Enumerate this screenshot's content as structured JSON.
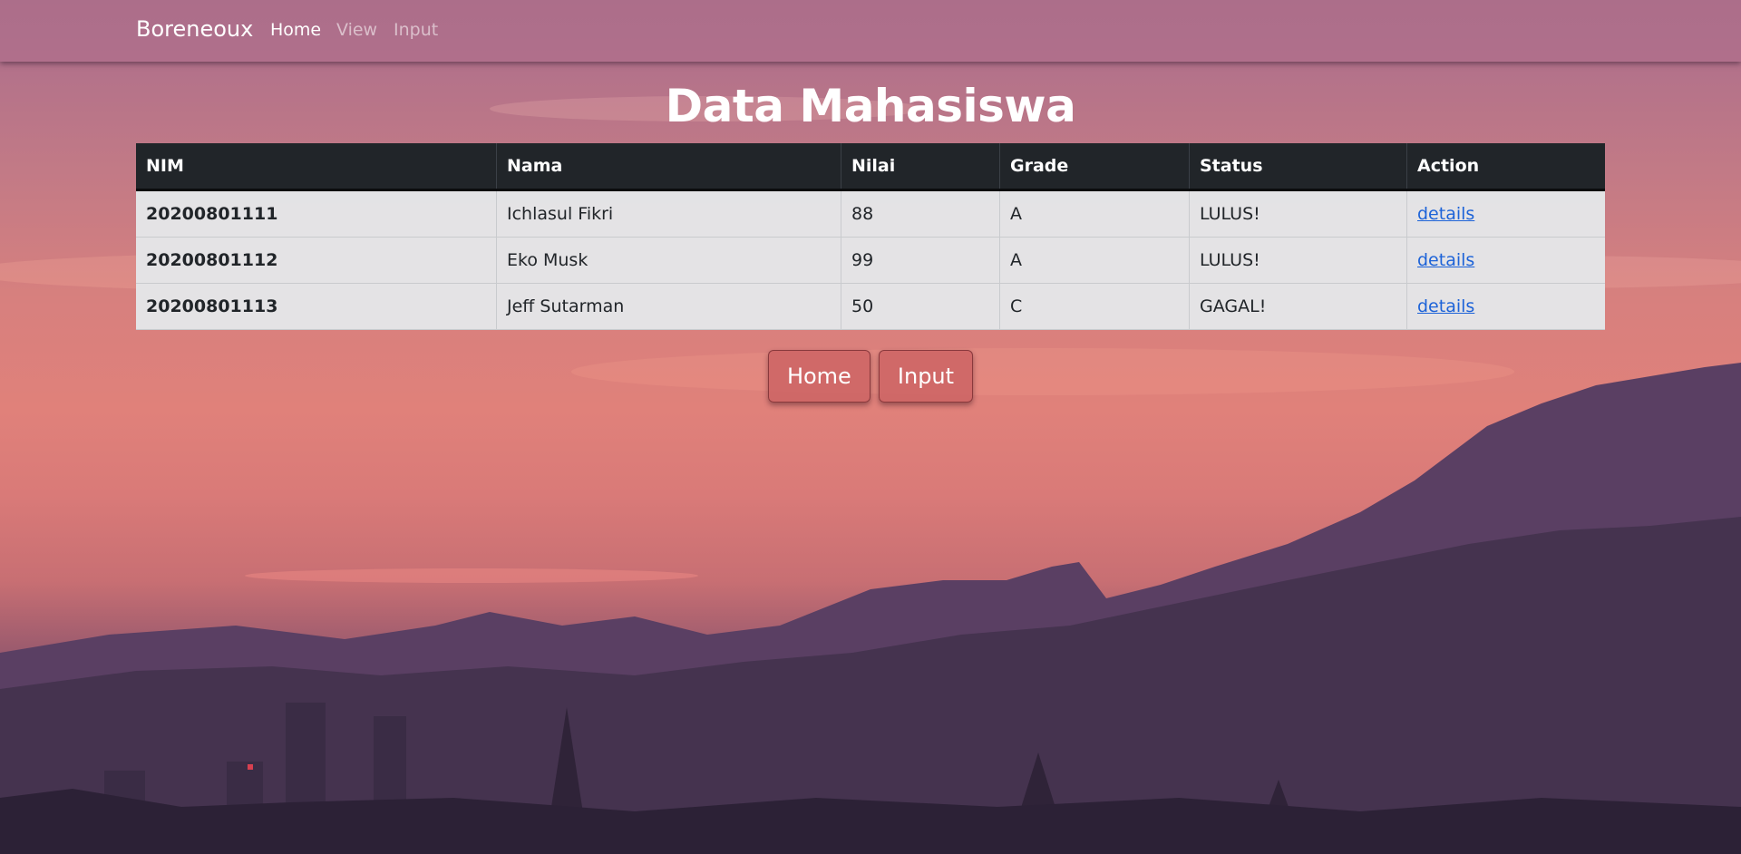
{
  "navbar": {
    "brand": "Boreneoux",
    "links": [
      {
        "label": "Home",
        "active": true
      },
      {
        "label": "View",
        "active": false
      },
      {
        "label": "Input",
        "active": false
      }
    ]
  },
  "main": {
    "title": "Data Mahasiswa",
    "table": {
      "headers": [
        "NIM",
        "Nama",
        "Nilai",
        "Grade",
        "Status",
        "Action"
      ],
      "rows": [
        {
          "nim": "20200801111",
          "nama": "Ichlasul Fikri",
          "nilai": "88",
          "grade": "A",
          "status": "LULUS!",
          "action": "details"
        },
        {
          "nim": "20200801112",
          "nama": "Eko Musk",
          "nilai": "99",
          "grade": "A",
          "status": "LULUS!",
          "action": "details"
        },
        {
          "nim": "20200801113",
          "nama": "Jeff Sutarman",
          "nilai": "50",
          "grade": "C",
          "status": "GAGAL!",
          "action": "details"
        }
      ]
    },
    "buttons": {
      "home": "Home",
      "input": "Input"
    }
  },
  "colors": {
    "header_bg": "#212529",
    "link": "#1d63d8",
    "button_bg": "#cd6464"
  }
}
